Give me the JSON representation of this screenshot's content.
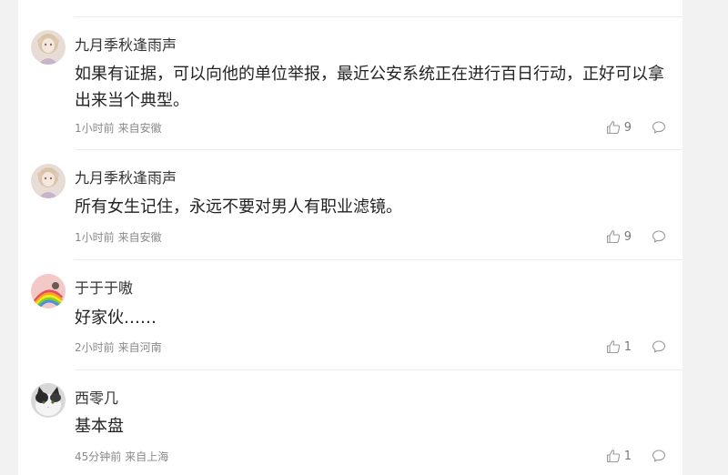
{
  "comments": [
    {
      "username": "九月季秋逢雨声",
      "text": "如果有证据，可以向他的单位举报，最近公安系统正在进行百日行动，正好可以拿出来当个典型。",
      "time": "1小时前",
      "location": "来自安徽",
      "likes": "9",
      "avatar_icon": "avatar-anime-girl-icon"
    },
    {
      "username": "九月季秋逢雨声",
      "text": "所有女生记住，永远不要对男人有职业滤镜。",
      "time": "1小时前",
      "location": "来自安徽",
      "likes": "9",
      "avatar_icon": "avatar-anime-girl-icon"
    },
    {
      "username": "于于于嗷",
      "text": "好家伙……",
      "time": "2小时前",
      "location": "来自河南",
      "likes": "1",
      "avatar_icon": "avatar-rainbow-icon"
    },
    {
      "username": "西零几",
      "text": "基本盘",
      "time": "45分钟前",
      "location": "来自上海",
      "likes": "1",
      "avatar_icon": "avatar-cat-icon"
    }
  ],
  "colors": {
    "background": "#f2f2f2",
    "card": "#ffffff",
    "text": "#222222",
    "meta": "#8a8a8a",
    "icon": "#9a9a9a"
  }
}
